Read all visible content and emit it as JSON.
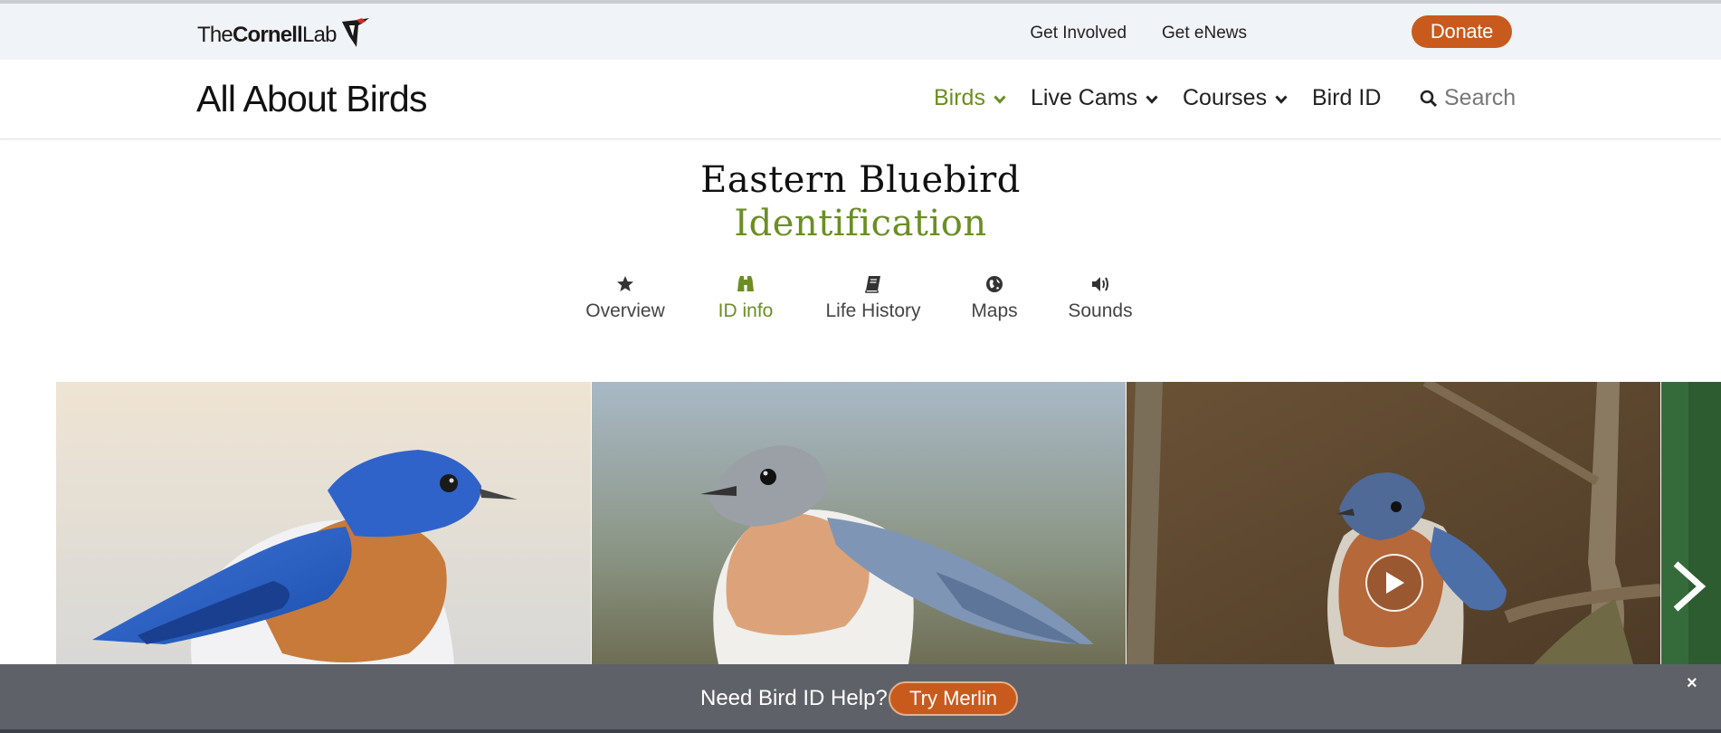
{
  "utility": {
    "logo_prefix": "The",
    "logo_bold": "Cornell",
    "logo_suffix": "Lab",
    "links": [
      "Get Involved",
      "Get eNews"
    ],
    "donate_label": "Donate"
  },
  "header": {
    "site_title": "All About Birds",
    "nav": [
      {
        "label": "Birds",
        "has_dropdown": true,
        "active": true
      },
      {
        "label": "Live Cams",
        "has_dropdown": true,
        "active": false
      },
      {
        "label": "Courses",
        "has_dropdown": true,
        "active": false
      },
      {
        "label": "Bird ID",
        "has_dropdown": false,
        "active": false
      }
    ],
    "search_placeholder": "Search"
  },
  "species": {
    "name": "Eastern Bluebird",
    "section": "Identification"
  },
  "tabs": [
    {
      "label": "Overview",
      "icon": "star-icon",
      "active": false
    },
    {
      "label": "ID info",
      "icon": "binoculars-icon",
      "active": true
    },
    {
      "label": "Life History",
      "icon": "book-icon",
      "active": false
    },
    {
      "label": "Maps",
      "icon": "globe-icon",
      "active": false
    },
    {
      "label": "Sounds",
      "icon": "speaker-icon",
      "active": false
    }
  ],
  "gallery": {
    "photos": [
      "adult-male-bluebird",
      "female-bluebird",
      "bluebird-video"
    ]
  },
  "merlin_bar": {
    "text": "Need Bird ID Help?",
    "button_label": "Try Merlin",
    "close": "×"
  },
  "colors": {
    "accent_green": "#6b8e23",
    "donate_orange": "#c95a1d",
    "utility_bg": "#f0f3f7",
    "merlin_bg": "#5e6268"
  }
}
